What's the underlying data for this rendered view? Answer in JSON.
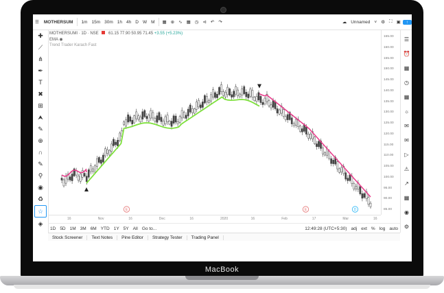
{
  "device": {
    "brand": "MacBook"
  },
  "toolbar": {
    "symbol": "MOTHERSUM",
    "intervals": [
      "1m",
      "15m",
      "30m",
      "1h",
      "4h",
      "D",
      "W",
      "M"
    ],
    "layout_name": "Unnamed",
    "badge_count": "3"
  },
  "legend": {
    "symbol_line": "MOTHERSUMI · 1D · NSE",
    "ohlc": [
      "61.15",
      "77.90",
      "50.95",
      "71.45",
      "+3.55 (+5.23%)"
    ],
    "ema": "EMA",
    "indicator": "Trend Trader Karach Fast"
  },
  "price_axis": [
    "165.00",
    "160.00",
    "155.00",
    "150.00",
    "145.00",
    "140.00",
    "135.00",
    "130.00",
    "125.00",
    "120.00",
    "115.00",
    "110.00",
    "105.00",
    "100.00",
    "95.00",
    "90.00",
    "85.00"
  ],
  "time_axis": [
    "16",
    "Nov",
    "16",
    "Dec",
    "16",
    "2020",
    "16",
    "Feb",
    "17",
    "Mar",
    "16"
  ],
  "event_markers": [
    {
      "letter": "E",
      "position": 0.21,
      "color": "#e57373"
    },
    {
      "letter": "E",
      "position": 0.79,
      "color": "#e57373"
    },
    {
      "letter": "D",
      "position": 0.95,
      "color": "#29b6f6"
    }
  ],
  "range_bar": {
    "ranges": [
      "1D",
      "5D",
      "1M",
      "3M",
      "6M",
      "YTD",
      "1Y",
      "5Y",
      "All"
    ],
    "goto": "Go to...",
    "time": "12:49:28 (UTC+5:30)",
    "options": [
      "adj",
      "ext",
      "%",
      "log",
      "auto"
    ]
  },
  "bottom_panels": [
    "Stock Screener",
    "Text Notes",
    "Pine Editor",
    "Strategy Tester",
    "Trading Panel"
  ],
  "colors": {
    "up_line": "#7ee03c",
    "down_line": "#e83e8c",
    "candle": "#444444"
  }
}
